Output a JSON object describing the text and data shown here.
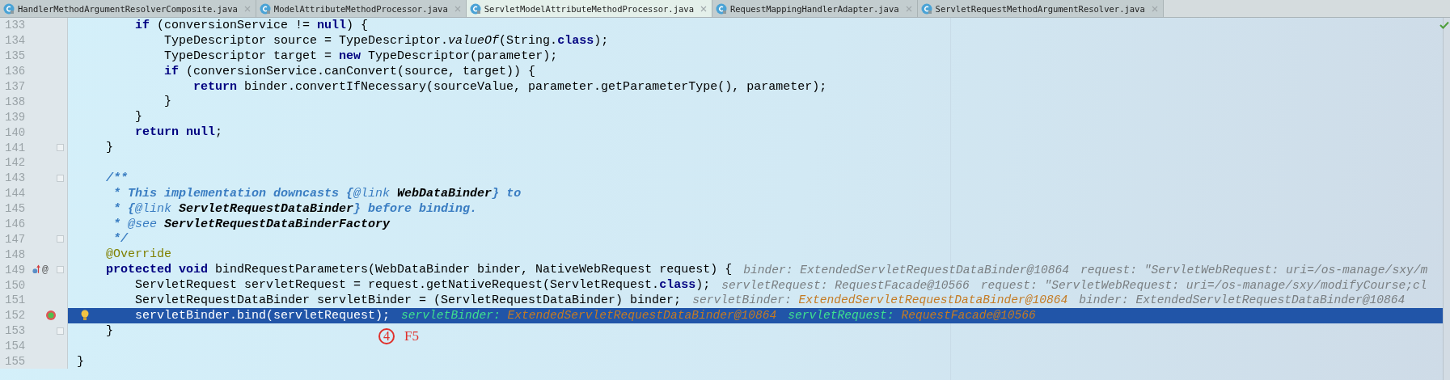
{
  "tabs": [
    {
      "label": "HandlerMethodArgumentResolverComposite.java",
      "selected": false
    },
    {
      "label": "ModelAttributeMethodProcessor.java",
      "selected": false
    },
    {
      "label": "ServletModelAttributeMethodProcessor.java",
      "selected": true
    },
    {
      "label": "RequestMappingHandlerAdapter.java",
      "selected": false
    },
    {
      "label": "ServletRequestMethodArgumentResolver.java",
      "selected": false
    }
  ],
  "lines": [
    {
      "number": "133",
      "selected": false,
      "fold": false,
      "tokens": [
        {
          "kind": "keyword",
          "text": "        if"
        },
        {
          "kind": "plain",
          "text": " (conversionService != "
        },
        {
          "kind": "keyword",
          "text": "null"
        },
        {
          "kind": "plain",
          "text": ") {"
        }
      ]
    },
    {
      "number": "134",
      "selected": false,
      "fold": false,
      "tokens": [
        {
          "kind": "plain",
          "text": "            TypeDescriptor source = TypeDescriptor."
        },
        {
          "kind": "static",
          "text": "valueOf"
        },
        {
          "kind": "plain",
          "text": "(String."
        },
        {
          "kind": "keyword",
          "text": "class"
        },
        {
          "kind": "plain",
          "text": ");"
        }
      ]
    },
    {
      "number": "135",
      "selected": false,
      "fold": false,
      "tokens": [
        {
          "kind": "plain",
          "text": "            TypeDescriptor target = "
        },
        {
          "kind": "keyword",
          "text": "new"
        },
        {
          "kind": "plain",
          "text": " TypeDescriptor(parameter);"
        }
      ]
    },
    {
      "number": "136",
      "selected": false,
      "fold": false,
      "tokens": [
        {
          "kind": "keyword",
          "text": "            if"
        },
        {
          "kind": "plain",
          "text": " (conversionService.canConvert(source, target)) {"
        }
      ]
    },
    {
      "number": "137",
      "selected": false,
      "fold": false,
      "tokens": [
        {
          "kind": "keyword",
          "text": "                return"
        },
        {
          "kind": "plain",
          "text": " binder.convertIfNecessary(sourceValue, parameter.getParameterType(), parameter);"
        }
      ]
    },
    {
      "number": "138",
      "selected": false,
      "fold": false,
      "tokens": [
        {
          "kind": "plain",
          "text": "            }"
        }
      ]
    },
    {
      "number": "139",
      "selected": false,
      "fold": false,
      "tokens": [
        {
          "kind": "plain",
          "text": "        }"
        }
      ]
    },
    {
      "number": "140",
      "selected": false,
      "fold": false,
      "tokens": [
        {
          "kind": "keyword",
          "text": "        return null"
        },
        {
          "kind": "plain",
          "text": ";"
        }
      ]
    },
    {
      "number": "141",
      "selected": false,
      "fold": true,
      "tokens": [
        {
          "kind": "plain",
          "text": "    }"
        }
      ]
    },
    {
      "number": "142",
      "selected": false,
      "fold": false
    },
    {
      "number": "143",
      "selected": false,
      "fold": true,
      "tokens": [
        {
          "kind": "doc",
          "text": "    /**"
        }
      ]
    },
    {
      "number": "144",
      "selected": false,
      "fold": false,
      "tokens": [
        {
          "kind": "doc",
          "text": "     * This implementation downcasts {"
        },
        {
          "kind": "doc-tag",
          "text": "@link"
        },
        {
          "kind": "doc-ref",
          "text": " WebDataBinder"
        },
        {
          "kind": "doc",
          "text": "} to"
        }
      ]
    },
    {
      "number": "145",
      "selected": false,
      "fold": false,
      "tokens": [
        {
          "kind": "doc",
          "text": "     * {"
        },
        {
          "kind": "doc-tag",
          "text": "@link"
        },
        {
          "kind": "doc-ref",
          "text": " ServletRequestDataBinder"
        },
        {
          "kind": "doc",
          "text": "} before binding."
        }
      ]
    },
    {
      "number": "146",
      "selected": false,
      "fold": false,
      "tokens": [
        {
          "kind": "doc",
          "text": "     * "
        },
        {
          "kind": "doc-tag",
          "text": "@see"
        },
        {
          "kind": "doc-ref",
          "text": " ServletRequestDataBinderFactory"
        }
      ]
    },
    {
      "number": "147",
      "selected": false,
      "fold": true,
      "tokens": [
        {
          "kind": "doc",
          "text": "     */"
        }
      ]
    },
    {
      "number": "148",
      "selected": false,
      "fold": false,
      "tokens": [
        {
          "kind": "annotation",
          "text": "    @Override"
        }
      ]
    },
    {
      "number": "149",
      "selected": false,
      "fold": true,
      "gutter_icons": [
        {
          "kind": "overriding"
        },
        {
          "kind": "symbol",
          "text": "@"
        }
      ],
      "tokens": [
        {
          "kind": "keyword",
          "text": "    protected void"
        },
        {
          "kind": "plain",
          "text": " bindRequestParameters(WebDataBinder binder, NativeWebRequest request) {"
        }
      ],
      "debug": [
        {
          "name": "binder:",
          "value": "ExtendedServletRequestDataBinder@10864",
          "changed": false
        },
        {
          "name": "request:",
          "value": "\"ServletWebRequest: uri=/os-manage/sxy/m",
          "changed": false
        }
      ]
    },
    {
      "number": "150",
      "selected": false,
      "fold": false,
      "tokens": [
        {
          "kind": "plain",
          "text": "        ServletRequest servletRequest = request.getNativeRequest(ServletRequest."
        },
        {
          "kind": "keyword",
          "text": "class"
        },
        {
          "kind": "plain",
          "text": ");"
        }
      ],
      "debug": [
        {
          "name": "servletRequest:",
          "value": "RequestFacade@10566",
          "changed": false
        },
        {
          "name": "request:",
          "value": "\"ServletWebRequest: uri=/os-manage/sxy/modifyCourse;cl",
          "changed": false
        }
      ]
    },
    {
      "number": "151",
      "selected": false,
      "fold": false,
      "tokens": [
        {
          "kind": "plain",
          "text": "        ServletRequestDataBinder servletBinder = (ServletRequestDataBinder) binder;"
        }
      ],
      "debug": [
        {
          "name": "servletBinder:",
          "value": "ExtendedServletRequestDataBinder@10864",
          "changed": true
        },
        {
          "name": "binder:",
          "value": "ExtendedServletRequestDataBinder@10864",
          "changed": false
        }
      ]
    },
    {
      "number": "152",
      "selected": true,
      "fold": false,
      "bulb": true,
      "gutter_icons": [
        {
          "kind": "breakpoint"
        }
      ],
      "tokens": [
        {
          "kind": "plain",
          "text": "        servletBinder.bind(servletRequest);"
        }
      ],
      "debug": [
        {
          "name": "servletBinder:",
          "value": "ExtendedServletRequestDataBinder@10864",
          "changed": true
        },
        {
          "name": "servletRequest:",
          "value": "RequestFacade@10566",
          "changed": true
        }
      ]
    },
    {
      "number": "153",
      "selected": false,
      "fold": true,
      "tokens": [
        {
          "kind": "plain",
          "text": "    }"
        }
      ]
    },
    {
      "number": "154",
      "selected": false,
      "fold": false
    },
    {
      "number": "155",
      "selected": false,
      "fold": false,
      "tokens": [
        {
          "kind": "plain",
          "text": "}"
        }
      ]
    }
  ],
  "overlay": {
    "step": "4",
    "key": "F5"
  }
}
